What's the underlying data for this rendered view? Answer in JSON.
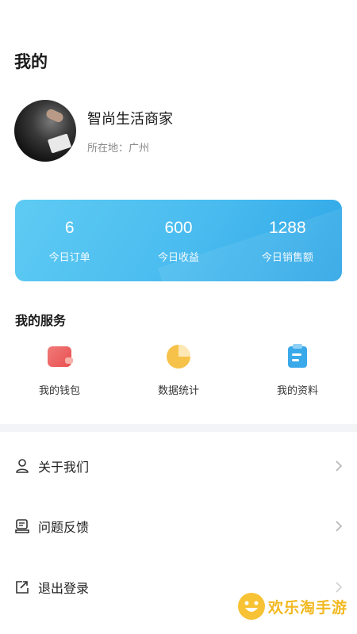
{
  "header": {
    "title": "我的"
  },
  "profile": {
    "shop_name": "智尚生活商家",
    "location": "所在地：广州"
  },
  "stats": [
    {
      "value": "6",
      "label": "今日订单"
    },
    {
      "value": "600",
      "label": "今日收益"
    },
    {
      "value": "1288",
      "label": "今日销售额"
    }
  ],
  "services": {
    "title": "我的服务",
    "items": [
      {
        "label": "我的钱包",
        "icon": "wallet-icon"
      },
      {
        "label": "数据统计",
        "icon": "pie-chart-icon"
      },
      {
        "label": "我的资料",
        "icon": "clipboard-icon"
      }
    ]
  },
  "menu": [
    {
      "label": "关于我们",
      "icon": "user-icon"
    },
    {
      "label": "问题反馈",
      "icon": "feedback-icon"
    },
    {
      "label": "退出登录",
      "icon": "logout-icon"
    }
  ],
  "watermark": {
    "text": "欢乐淘手游"
  },
  "colors": {
    "card_start": "#5ecbf3",
    "card_end": "#2ea6e6",
    "watermark": "#f2b81f"
  }
}
